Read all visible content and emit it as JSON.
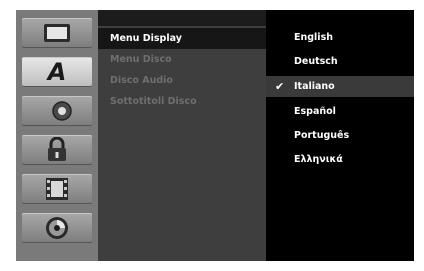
{
  "sidebar": {
    "items": [
      {
        "icon": "tv-screen-icon",
        "active": false
      },
      {
        "icon": "language-a-icon",
        "label": "A",
        "active": true
      },
      {
        "icon": "speaker-audio-icon",
        "active": false
      },
      {
        "icon": "padlock-icon",
        "active": false
      },
      {
        "icon": "film-icon",
        "active": false
      },
      {
        "icon": "disc-icon",
        "active": false
      }
    ]
  },
  "menu": {
    "items": [
      {
        "label": "Menu Display",
        "state": "selected"
      },
      {
        "label": "Menu Disco",
        "state": "disabled"
      },
      {
        "label": "Disco Audio",
        "state": "disabled"
      },
      {
        "label": "Sottotitoli Disco",
        "state": "disabled"
      }
    ]
  },
  "options": {
    "items": [
      {
        "label": "English"
      },
      {
        "label": "Deutsch"
      },
      {
        "label": "Italiano",
        "selected": true
      },
      {
        "label": "Español"
      },
      {
        "label": "Português"
      },
      {
        "label": "Ελληνικά"
      }
    ],
    "check_glyph": "✔"
  },
  "colors": {
    "background": "#000000",
    "sidebar": "#7a7a7a",
    "panel": "#3e3e3e",
    "highlight": "#161616",
    "disabled_text": "#6f6f6f"
  }
}
